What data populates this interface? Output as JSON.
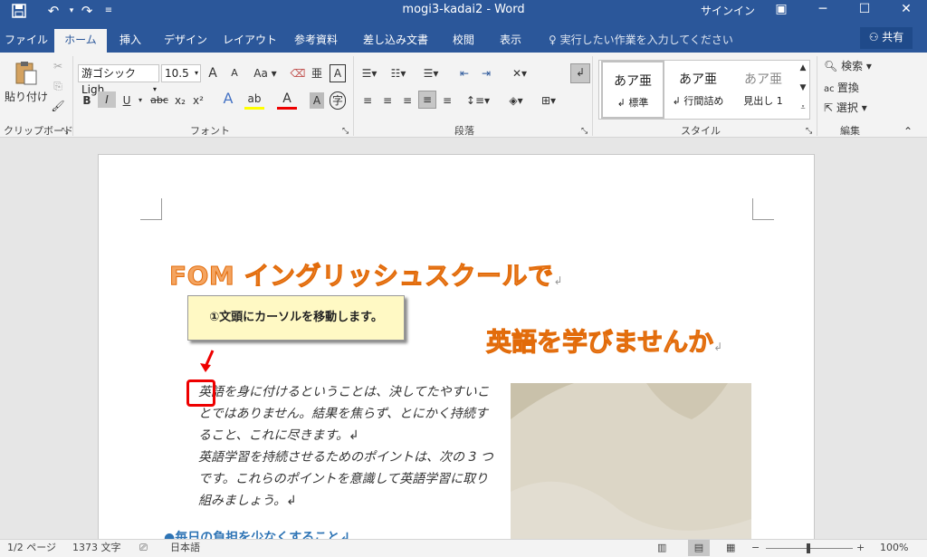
{
  "titlebar": {
    "title": "mogi3-kadai2 - Word",
    "signin": "サインイン",
    "save_icon": "save-icon",
    "undo_icon": "undo-icon",
    "redo_icon": "redo-icon",
    "customize_icon": "customize-icon",
    "ribbon_display_icon": "ribbon-display-icon",
    "minimize": "─",
    "maximize": "☐",
    "close": "✕"
  },
  "tabs": [
    {
      "label": "ファイル"
    },
    {
      "label": "ホーム"
    },
    {
      "label": "挿入"
    },
    {
      "label": "デザイン"
    },
    {
      "label": "レイアウト"
    },
    {
      "label": "参考資料"
    },
    {
      "label": "差し込み文書"
    },
    {
      "label": "校閲"
    },
    {
      "label": "表示"
    }
  ],
  "tellme": "実行したい作業を入力してください",
  "share": "共有",
  "ribbon": {
    "clipboard": {
      "paste_label": "貼り付け",
      "group": "クリップボード"
    },
    "font": {
      "font_name": "游ゴシック Ligh",
      "font_size": "10.5",
      "group": "フォント",
      "bold": "B",
      "italic": "I",
      "underline": "U",
      "strike": "abc",
      "sub": "x₂",
      "sup": "x²",
      "grow": "A",
      "shrink": "A",
      "case": "Aa",
      "char_a": "A"
    },
    "paragraph": {
      "group": "段落"
    },
    "styles": {
      "group": "スタイル",
      "items": [
        {
          "preview": "あア亜",
          "name": "↲ 標準"
        },
        {
          "preview": "あア亜",
          "name": "↲ 行間詰め"
        },
        {
          "preview": "あア亜",
          "name": "見出し 1"
        }
      ]
    },
    "editing": {
      "group": "編集",
      "find": "検索",
      "replace": "置換",
      "select": "選択"
    }
  },
  "document": {
    "heading1": "FOM イングリッシュスクールで",
    "heading2": "英語を学びませんか",
    "callout": "①文頭にカーソルを移動します。",
    "paragraphs": [
      "英語を身に付けるということは、決してたやすいことではありません。結果を焦らず、とにかく持続すること、これに尽きます。↲",
      "英語学習を持続させるためのポイントは、次の 3 つです。これらのポイントを意識して英語学習に取り組みましょう。↲"
    ],
    "heading3": "●毎日の負担を少なくすること↲",
    "para_mark": "↲"
  },
  "status": {
    "page": "1/2 ページ",
    "words": "1373 文字",
    "lang": "日本語",
    "zoom": "100%"
  },
  "colors": {
    "brand": "#2b579a",
    "heading": "#e26b0a",
    "callout_bg": "#fff9c4",
    "highlight": "#e00000"
  }
}
